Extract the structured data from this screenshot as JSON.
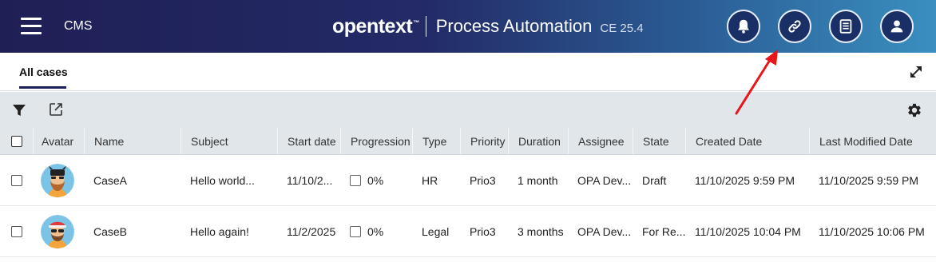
{
  "header": {
    "app_name": "CMS",
    "brand_logo": "opentext",
    "brand_tm": "™",
    "product": "Process Automation",
    "version": "CE 25.4",
    "buttons": [
      {
        "icon": "bell-icon"
      },
      {
        "icon": "link-icon"
      },
      {
        "icon": "notes-icon"
      },
      {
        "icon": "user-icon"
      }
    ]
  },
  "tabs": {
    "active": "All cases"
  },
  "toolbar": {
    "icons": [
      "filter-icon",
      "export-icon",
      "gear-icon"
    ]
  },
  "table": {
    "columns": {
      "avatar": "Avatar",
      "name": "Name",
      "subject": "Subject",
      "start_date": "Start date",
      "progression": "Progression",
      "type": "Type",
      "priority": "Priority",
      "duration": "Duration",
      "assignee": "Assignee",
      "state": "State",
      "created_date": "Created Date",
      "last_modified_date": "Last Modified Date"
    },
    "rows": [
      {
        "name": "CaseA",
        "subject": "Hello world...",
        "start_date": "11/10/2...",
        "progression": "0%",
        "type": "HR",
        "priority": "Prio3",
        "duration": "1 month",
        "assignee": "OPA Dev...",
        "state": "Draft",
        "created_date": "11/10/2025 9:59 PM",
        "last_modified_date": "11/10/2025 9:59 PM"
      },
      {
        "name": "CaseB",
        "subject": "Hello again!",
        "start_date": "11/2/2025",
        "progression": "0%",
        "type": "Legal",
        "priority": "Prio3",
        "duration": "3 months",
        "assignee": "OPA Dev...",
        "state": "For Re...",
        "created_date": "11/10/2025 10:04 PM",
        "last_modified_date": "11/10/2025 10:06 PM"
      }
    ]
  },
  "colors": {
    "header_start": "#1f1f55",
    "header_end": "#3a8fc0",
    "toolbar_bg": "#e1e6ea",
    "annotation_arrow": "#e8151b"
  }
}
